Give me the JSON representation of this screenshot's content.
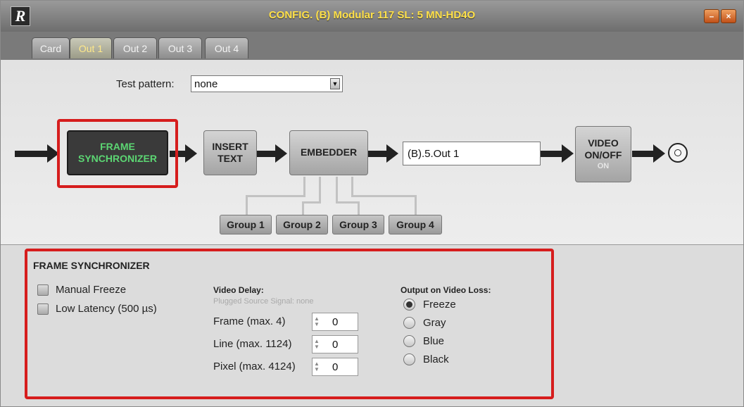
{
  "window": {
    "logo": "R",
    "title": "CONFIG. (B) Modular 117 SL: 5 MN-HD4O",
    "buttons": [
      "minimize-icon",
      "close-icon"
    ]
  },
  "tabs": [
    {
      "label": "Card",
      "active": false
    },
    {
      "label": "Out 1",
      "active": true
    },
    {
      "label": "Out 2",
      "active": false
    },
    {
      "label": "Out 3",
      "active": false
    },
    {
      "label": "Out 4",
      "active": false
    }
  ],
  "test_pattern": {
    "label": "Test pattern:",
    "value": "none"
  },
  "pipeline": {
    "frame_sync": [
      "FRAME",
      "SYNCHRONIZER"
    ],
    "insert_text": [
      "INSERT",
      "TEXT"
    ],
    "embedder": "EMBEDDER",
    "output_name": "(B).5.Out 1",
    "video_onoff": [
      "VIDEO",
      "ON/OFF",
      "ON"
    ],
    "groups": [
      "Group 1",
      "Group 2",
      "Group 3",
      "Group 4"
    ]
  },
  "frame_synchronizer": {
    "title": "FRAME SYNCHRONIZER",
    "checkboxes": [
      {
        "label": "Manual Freeze",
        "checked": false
      },
      {
        "label": "Low Latency (500 µs)",
        "checked": false
      }
    ],
    "video_delay": {
      "heading": "Video Delay:",
      "note": "Plugged Source Signal: none",
      "fields": [
        {
          "label": "Frame (max. 4)",
          "value": "0"
        },
        {
          "label": "Line (max. 1124)",
          "value": "0"
        },
        {
          "label": "Pixel (max. 4124)",
          "value": "0"
        }
      ]
    },
    "video_loss": {
      "heading": "Output on Video Loss:",
      "options": [
        {
          "label": "Freeze",
          "selected": true
        },
        {
          "label": "Gray",
          "selected": false
        },
        {
          "label": "Blue",
          "selected": false
        },
        {
          "label": "Black",
          "selected": false
        }
      ]
    }
  },
  "colors": {
    "highlight": "#d61d1d",
    "title_text": "#ffe14a",
    "active_block_text": "#5cd673"
  }
}
